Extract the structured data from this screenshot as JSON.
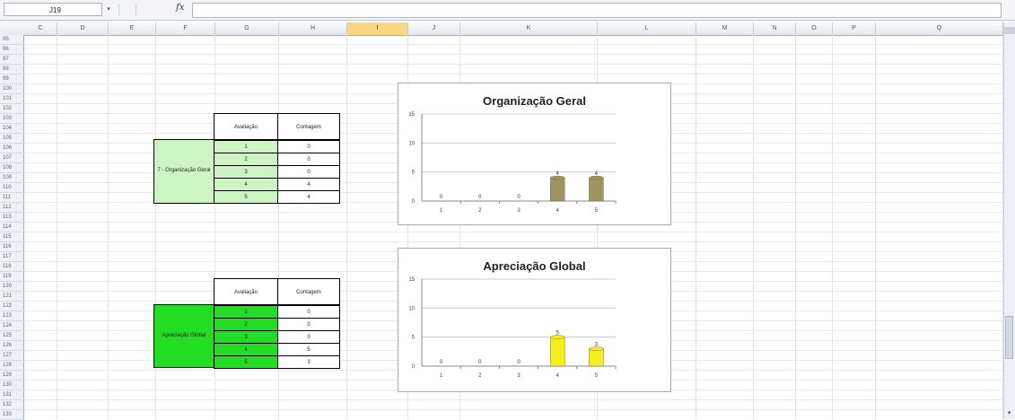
{
  "formula_bar": {
    "name_box": "J19",
    "fx": "fx",
    "formula": ""
  },
  "columns": [
    {
      "label": "C",
      "w": 37
    },
    {
      "label": "D",
      "w": 57
    },
    {
      "label": "E",
      "w": 53
    },
    {
      "label": "F",
      "w": 66
    },
    {
      "label": "G",
      "w": 71
    },
    {
      "label": "H",
      "w": 76
    },
    {
      "label": "I",
      "w": 68,
      "selected": true
    },
    {
      "label": "J",
      "w": 58
    },
    {
      "label": "K",
      "w": 153
    },
    {
      "label": "L",
      "w": 110
    },
    {
      "label": "M",
      "w": 64
    },
    {
      "label": "N",
      "w": 47
    },
    {
      "label": "O",
      "w": 41
    },
    {
      "label": "P",
      "w": 48
    },
    {
      "label": "Q",
      "w": 142
    }
  ],
  "rows": [
    "95",
    "96",
    "97",
    "98",
    "99",
    "100",
    "101",
    "102",
    "103",
    "104",
    "105",
    "106",
    "107",
    "108",
    "109",
    "110",
    "111",
    "112",
    "113",
    "114",
    "115",
    "116",
    "117",
    "118",
    "119",
    "120",
    "121",
    "122",
    "123",
    "124",
    "125",
    "126",
    "127",
    "128",
    "129",
    "130",
    "131",
    "132",
    "133"
  ],
  "table1": {
    "label": "7 - Organização Geral",
    "header_avaliacao": "Avaliação",
    "header_contagem": "Contagem",
    "label_color": "#cdf5c3",
    "avaliacao": [
      "1",
      "2",
      "3",
      "4",
      "5"
    ],
    "contagem": [
      "0",
      "0",
      "0",
      "4",
      "4"
    ]
  },
  "table2": {
    "label": "Apreciação Global",
    "header_avaliacao": "Avaliação",
    "header_contagem": "Contagem",
    "label_color": "#22dd22",
    "avaliacao": [
      "1",
      "2",
      "3",
      "4",
      "5"
    ],
    "contagem": [
      "0",
      "0",
      "0",
      "5",
      "3"
    ]
  },
  "chart_data": [
    {
      "type": "bar",
      "title": "Organização Geral",
      "categories": [
        "1",
        "2",
        "3",
        "4",
        "5"
      ],
      "values": [
        0,
        0,
        0,
        4,
        4
      ],
      "data_labels": [
        "0",
        "0",
        "0",
        "4",
        "4"
      ],
      "ylim": [
        0,
        15
      ],
      "yticks": [
        "0",
        "5",
        "10",
        "15"
      ],
      "grid": true,
      "bar_color": "#9c9461"
    },
    {
      "type": "bar",
      "title": "Apreciação Global",
      "categories": [
        "1",
        "2",
        "3",
        "4",
        "5"
      ],
      "values": [
        0,
        0,
        0,
        5,
        3
      ],
      "data_labels": [
        "0",
        "0",
        "0",
        "5",
        "3"
      ],
      "ylim": [
        0,
        15
      ],
      "yticks": [
        "0",
        "5",
        "10",
        "15"
      ],
      "grid": true,
      "bar_color": "#f7ef1c"
    }
  ]
}
